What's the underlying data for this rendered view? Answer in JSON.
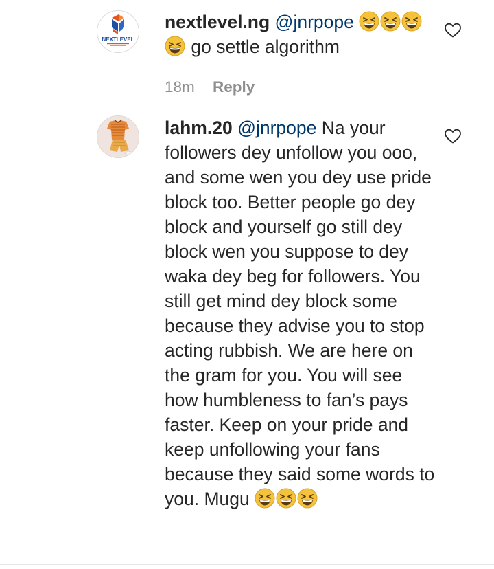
{
  "comments": [
    {
      "username": "nextlevel.ng",
      "mention": "@jnrpope",
      "text_before_emoji": "",
      "text": "go settle algorithm",
      "emoji_name": "grinning-squinting-face",
      "time": "18m",
      "reply_label": "Reply",
      "avatar_text": "NEXTLEVEL"
    },
    {
      "username": "lahm.20",
      "mention": "@jnrpope",
      "text": "Na your followers dey unfollow you ooo, and some wen you dey use pride block too. Better people go dey block and yourself go still dey block wen you suppose to dey waka dey beg for followers. You still get mind dey block some because they advise you to stop acting rubbish. We are here on the gram for you. You will see how humbleness to fan’s pays faster. Keep on your pride and keep unfollowing your fans because they said some words to you. Mugu",
      "emoji_name": "grinning-squinting-face"
    }
  ],
  "colors": {
    "text": "#262626",
    "mention": "#00376b",
    "meta": "#8e8e8e",
    "emoji": "#f5c33b"
  },
  "icons": {
    "like": "heart-outline-icon",
    "emoji": "grinning-squinting-face-icon"
  }
}
